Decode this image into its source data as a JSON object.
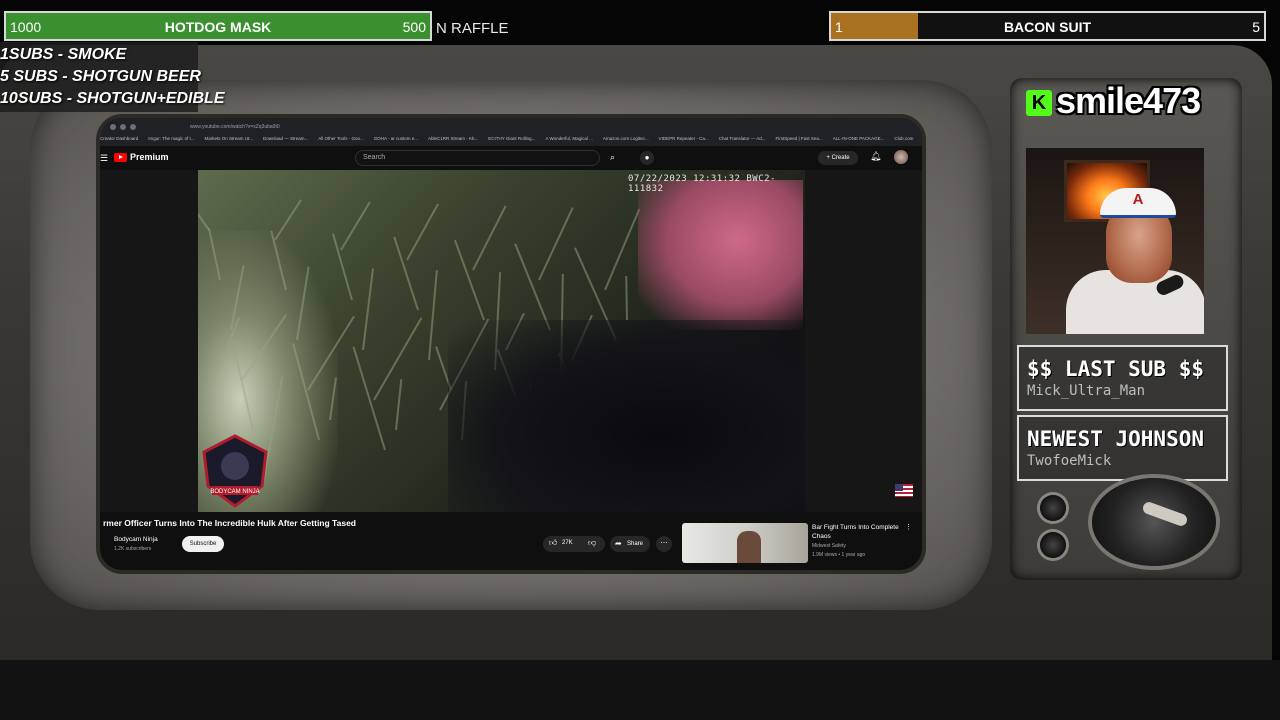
{
  "goals": {
    "hotdog": {
      "min": "1000",
      "title": "HOTDOG MASK",
      "max": "500",
      "progress": 1.0,
      "color": "#3a8f2f"
    },
    "bacon": {
      "min": "1",
      "title": "BACON SUIT",
      "max": "5",
      "progress": 0.2,
      "color": "#a8701f"
    },
    "raffle_text": "N RAFFLE"
  },
  "sub_rewards": [
    "1SUBS   - SMOKE",
    "5 SUBS  - SHOTGUN BEER",
    "10SUBS - SHOTGUN+EDIBLE"
  ],
  "browser": {
    "url": "www.youtube.com/watch?v=xZq3uba9t0",
    "bookmarks": [
      "Creator Dashboard",
      "Imgur: The magic of t...",
      "Markets On Stream Ut...",
      "Download — Stream...",
      "All Other Tools - Goo...",
      "GOHA - ar custom e...",
      "AbleC1RR Stream - Kb...",
      "ECITHY Giant Rolling...",
      "A Wonderful, Magical ...",
      "Amazon.com Logitec...",
      "VIDEPR Repeater - Ca...",
      "Chat Translator — Ad...",
      "FirstSpeed | Fast Sea...",
      "ALL-IN-ONE PACKAGE...",
      "Club.com"
    ]
  },
  "youtube": {
    "logo": "Premium",
    "search_placeholder": "Search",
    "create_label": "Create",
    "icons": {
      "menu": "menu-icon",
      "search": "search-icon",
      "mic": "mic-icon",
      "bell": "bell-icon"
    },
    "video": {
      "timestamp": "07/22/2023 12:31:32   BWC2-111832",
      "title": "rmer Officer Turns Into The Incredible Hulk After Getting Tased",
      "channel": "Bodycam Ninja",
      "subscribers": "1.2K subscribers",
      "subscribe_label": "Subscribe",
      "likes": "27K",
      "share_label": "Share",
      "badge_text": "BODYCAM NINJA"
    },
    "recommended": {
      "title": "Bar Fight Turns Into Complete Chaos",
      "channel": "Midwest Safety",
      "meta": "1.9M views • 1 year ago"
    }
  },
  "streamer": {
    "platform_icon": "kick-icon",
    "username": "smile473"
  },
  "last_sub": {
    "heading": "$$ LAST SUB $$",
    "name": "Mick_Ultra_Man"
  },
  "newest_follower": {
    "heading": "NEWEST JOHNSON",
    "name": "TwofoeMick"
  }
}
